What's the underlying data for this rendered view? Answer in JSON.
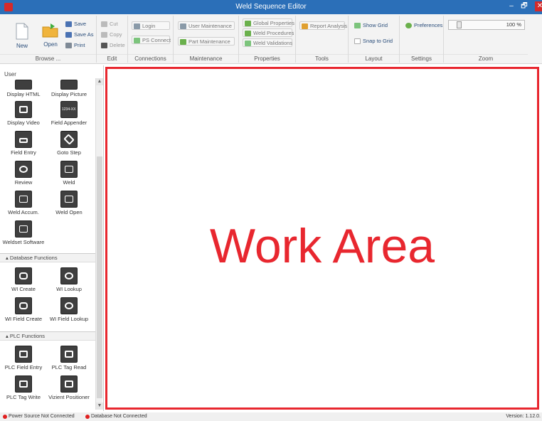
{
  "window": {
    "title": "Weld Sequence Editor",
    "minimize": "–",
    "maximize": "🗗",
    "close": "✕"
  },
  "colors": {
    "titlebar": "#2b6fb8",
    "work_area_border": "#e8272f",
    "status_red": "#e02020"
  },
  "ribbon": {
    "browse": {
      "label": "Browse ...",
      "new": "New",
      "open": "Open",
      "save": "Save",
      "save_as": "Save As",
      "print": "Print"
    },
    "edit": {
      "label": "Edit",
      "cut": "Cut",
      "copy": "Copy",
      "delete": "Delete"
    },
    "connections": {
      "label": "Connections",
      "login": "Login",
      "ps_connect": "PS Connect"
    },
    "maintenance": {
      "label": "Maintenance",
      "user": "User Maintenance",
      "part": "Part Maintenance"
    },
    "properties": {
      "label": "Properties",
      "global": "Global Properties",
      "procedures": "Weld Procedures",
      "validations": "Weld Validations"
    },
    "tools": {
      "label": "Tools",
      "report": "Report Analysis"
    },
    "layout": {
      "label": "Layout",
      "show_grid": "Show Grid",
      "snap_to_grid": "Snap to Grid"
    },
    "settings": {
      "label": "Settings",
      "preferences": "Preferences"
    },
    "zoom": {
      "label": "Zoom",
      "value_text": "100 %",
      "level": 0.1
    }
  },
  "sidebar": {
    "user_label": "User",
    "user_tools": [
      "Display HTML",
      "Display Picture",
      "Display Video",
      "Field Appender",
      "Field Entry",
      "Goto Step",
      "Review",
      "Weld",
      "Weld Accum.",
      "Weld Open",
      "Weldset Software"
    ],
    "database_header": "Database Functions",
    "database_tools": [
      "WI Create",
      "WI Lookup",
      "WI Field Create",
      "WI Field Lookup"
    ],
    "plc_header": "PLC Functions",
    "plc_tools": [
      "PLC Field Entry",
      "PLC Tag Read",
      "PLC Tag Write",
      "Vizient Positioner"
    ],
    "field_appender_glyph": "1234-XX"
  },
  "work_area": {
    "label": "Work Area"
  },
  "status": {
    "power": "Power Source Not Connected",
    "database": "Database Not Connected",
    "version": "Version: 1.12.0."
  }
}
